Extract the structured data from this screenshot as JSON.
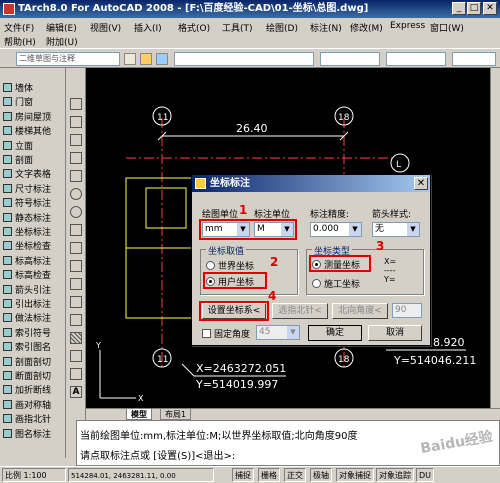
{
  "window": {
    "title": "TArch8.0 For AutoCAD 2008 - [F:\\百度经验-CAD\\01-坐标\\总图.dwg]",
    "min": "_",
    "max": "□",
    "close": "✕"
  },
  "menubar": {
    "row1": [
      "文件(F)",
      "编辑(E)",
      "视图(V)",
      "插入(I)",
      "格式(O)",
      "工具(T)",
      "绘图(D)",
      "标注(N)",
      "修改(M)",
      "Express",
      "窗口(W)"
    ],
    "row2": [
      "帮助(H)",
      "附加(U)"
    ]
  },
  "toolbar": {
    "layer_combo": "二维草图与注释"
  },
  "leftpanel": {
    "items": [
      "墙体",
      "门窗",
      "房间屋顶",
      "楼梯其他",
      "立面",
      "剖面",
      "文字表格",
      "尺寸标注",
      "符号标注",
      "静态标注",
      "坐标标注",
      "坐标检查",
      "标高标注",
      "标高检查",
      "箭头引注",
      "引出标注",
      "做法标注",
      "索引符号",
      "索引图名",
      "剖面剖切",
      "断面剖切",
      "加折断线",
      "画对称轴",
      "画指北针",
      "图名标注"
    ]
  },
  "drawing": {
    "dimension": "26.40",
    "axis_labels": [
      "11",
      "18",
      "L",
      "11",
      "18"
    ],
    "coord1_x": "X=2463272.051",
    "coord1_y": "Y=514019.997",
    "coord2_x": "58.920",
    "coord2_y": "Y=514046.211"
  },
  "tabs": [
    "模型",
    "布局1"
  ],
  "command": {
    "line1": "当前绘图单位:mm,标注单位:M;以世界坐标取值;北向角度90度",
    "line2": "请点取标注点或 [设置(S)]<退出>:"
  },
  "status": {
    "scale": "比例 1:100",
    "coords": "514284.01, 2463281.11, 0.00",
    "toggles": [
      "捕捉",
      "栅格",
      "正交",
      "极轴",
      "对象捕捉",
      "对象追踪",
      "DU"
    ]
  },
  "dialog": {
    "title": "坐标标注",
    "drawing_unit_label": "绘图单位",
    "drawing_unit_value": "mm",
    "annot_unit_label": "标注单位",
    "annot_unit_value": "M",
    "precision_label": "标注精度:",
    "precision_value": "0.000",
    "arrow_label": "箭头样式:",
    "arrow_value": "无",
    "coord_source_label": "坐标取值",
    "world_coord": "世界坐标",
    "user_coord": "用户坐标",
    "coord_type_label": "坐标类型",
    "measured_coord": "测量坐标",
    "construction_coord": "施工坐标",
    "xy_sample": "X=\n----\nY=",
    "set_coord_button": "设置坐标系<",
    "pick_north_button": "选指北针<",
    "north_angle_button": "北向角度<",
    "north_angle_value": "90",
    "fixed_angle_label": "固定角度",
    "fixed_angle_value": "45",
    "ok_button": "确定",
    "cancel_button": "取消",
    "markers": [
      "1",
      "2",
      "3",
      "4"
    ]
  },
  "watermark": "Baidu经验",
  "colors": {
    "accent_red": "#e00000",
    "title_blue": "#0a246a",
    "canvas": "#000000"
  }
}
